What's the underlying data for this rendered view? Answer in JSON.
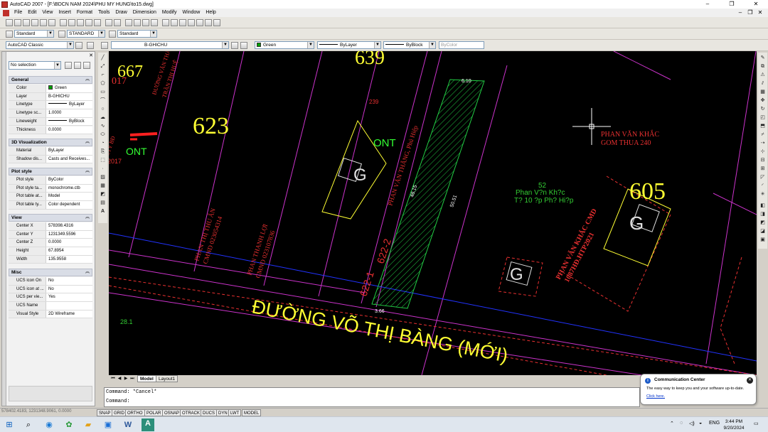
{
  "window": {
    "title": "AutoCAD 2007 - [F:\\BDCN NAM 2024\\PHU MY HUNG\\to15.dwg]",
    "controls": [
      "–",
      "❐",
      "✕"
    ]
  },
  "menubar": {
    "items": [
      "File",
      "Edit",
      "View",
      "Insert",
      "Format",
      "Tools",
      "Draw",
      "Dimension",
      "Modify",
      "Window",
      "Help"
    ],
    "mdi_controls": [
      "–",
      "❐",
      "✕"
    ]
  },
  "toolbars": {
    "text_style": "Standard",
    "dim_style": "STANDARD",
    "table_style": "Standard",
    "workspace": "AutoCAD Classic",
    "layer": "B-GHICHU",
    "color": "Green",
    "linetype": "ByLayer",
    "lineweight": "ByBlock",
    "plotstyle": "ByColor",
    "small_combo": "Standard"
  },
  "properties": {
    "selection": "No selection",
    "sections": {
      "general": "General",
      "viz": "3D Visualization",
      "plot": "Plot style",
      "view": "View",
      "misc": "Misc"
    },
    "general": [
      {
        "k": "Color",
        "v": "Green"
      },
      {
        "k": "Layer",
        "v": "B-GHICHU"
      },
      {
        "k": "Linetype",
        "v": "ByLayer"
      },
      {
        "k": "Linetype sc...",
        "v": "1.0000"
      },
      {
        "k": "Lineweight",
        "v": "ByBlock"
      },
      {
        "k": "Thickness",
        "v": "0.0000"
      }
    ],
    "viz": [
      {
        "k": "Material",
        "v": "ByLayer"
      },
      {
        "k": "Shadow dis...",
        "v": "Casts and Receives..."
      }
    ],
    "plot": [
      {
        "k": "Plot style",
        "v": "ByColor"
      },
      {
        "k": "Plot style ta...",
        "v": "monochrome.ctb"
      },
      {
        "k": "Plot table at...",
        "v": "Model"
      },
      {
        "k": "Plot table ty...",
        "v": "Color dependent"
      }
    ],
    "view": [
      {
        "k": "Center X",
        "v": "578398.4316"
      },
      {
        "k": "Center Y",
        "v": "1231349.5596"
      },
      {
        "k": "Center Z",
        "v": "0.0000"
      },
      {
        "k": "Height",
        "v": "67.8954"
      },
      {
        "k": "Width",
        "v": "135.9558"
      }
    ],
    "misc": [
      {
        "k": "UCS icon On",
        "v": "No"
      },
      {
        "k": "UCS icon at ...",
        "v": "No"
      },
      {
        "k": "UCS per vie...",
        "v": "Yes"
      },
      {
        "k": "UCS Name",
        "v": ""
      },
      {
        "k": "Visual Style",
        "v": "2D Wireframe"
      }
    ]
  },
  "drawing": {
    "parcels": [
      "667",
      "639",
      "623",
      "605",
      "017",
      "2017"
    ],
    "labels": {
      "ont_left": "ONT",
      "ont_center": "ONT",
      "g_mark": "G",
      "owner_right": "PHAN VĂN KHẮC",
      "owner_right_sub": "GOM THUA 240",
      "note_52": "52",
      "note_name": "Phan V?n Kh?c",
      "note_addr": "T? 10 ?p Ph? Hi?p",
      "thua_622_2": "622-2",
      "thua_622_1": "622-1",
      "street": "ĐƯỜNG VÕ THỊ BÀNG (MỚI)",
      "dim_top": "6.10",
      "dim_bottom": "3.66",
      "dim_len1": "50.51",
      "dim_len2": "48.15",
      "num_239": "239",
      "num_28_1": "28.1",
      "vert_thang": "PHAN VĂN THẮNG, Phú Hiệp",
      "vert_left_a": "PHAN THỊ THU ÂN",
      "vert_left_a2": "CMND 023054314",
      "vert_left_b": "PHAN THANH LỢI",
      "vert_left_b2": "CMND 023107836",
      "vert_khac": "PHAN VĂN KHẮC CMD",
      "vert_khac2": "1087HĐ.HTP2021",
      "vert_top_a": "ĐƯỜNG VĂN THẮNG",
      "vert_top_b": "TRẦN THỊ HUỆ",
      "vert_left_edge": "CTY BĐ"
    }
  },
  "tabs": {
    "nav": [
      "⏮",
      "◀",
      "▶",
      "⏭"
    ],
    "model": "Model",
    "layout": "Layout1"
  },
  "command": {
    "line1": "Command: *Cancel*",
    "line2": "Command:"
  },
  "status": {
    "coords": "578402.4183, 1231348.9061, 0.0000",
    "buttons": [
      "SNAP",
      "GRID",
      "ORTHO",
      "POLAR",
      "OSNAP",
      "OTRACK",
      "DUCS",
      "DYN",
      "LWT",
      "MODEL"
    ]
  },
  "comm_center": {
    "title": "Communication Center",
    "message": "The easy way to keep you and your software up-to-date.",
    "link": "Click here."
  },
  "taskbar": {
    "lang": "ENG",
    "time": "3:44 PM",
    "date": "9/20/2024"
  },
  "colors": {
    "canvas": "#000000",
    "parcel_yellow": "#ffff33",
    "red_text": "#e83030",
    "green_text": "#33ff33",
    "magenta_line": "#cc33cc",
    "blue_line": "#2233ff"
  }
}
